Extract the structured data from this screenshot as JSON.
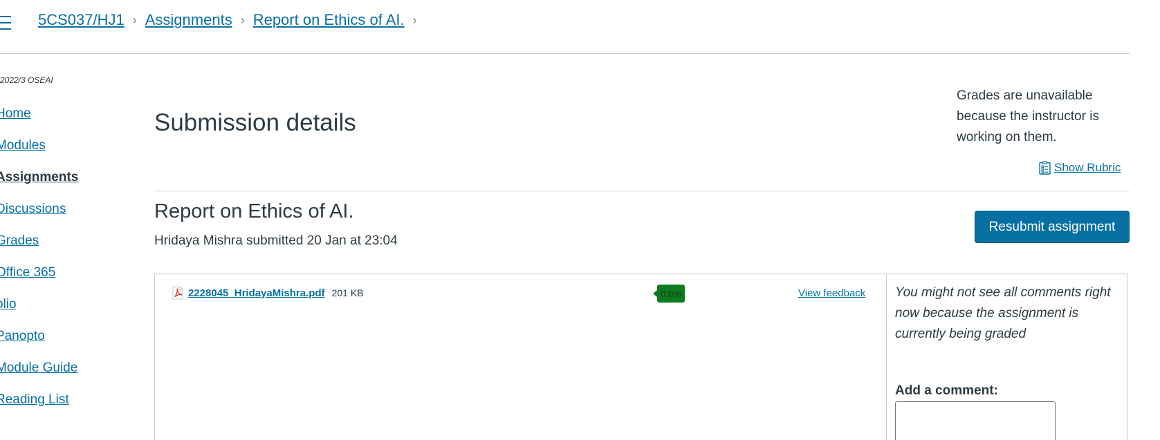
{
  "breadcrumb": {
    "course": "5CS037/HJ1",
    "assignments": "Assignments",
    "current": "Report on Ethics of AI."
  },
  "sidebar": {
    "term": "2022/3 OSEAI",
    "items": [
      {
        "label": "Home"
      },
      {
        "label": "Modules"
      },
      {
        "label": "Assignments"
      },
      {
        "label": "Discussions"
      },
      {
        "label": "Grades"
      },
      {
        "label": "Office 365"
      },
      {
        "label": "olio"
      },
      {
        "label": "Panopto"
      },
      {
        "label": "Module Guide"
      },
      {
        "label": "Reading List"
      }
    ]
  },
  "main": {
    "title": "Submission details",
    "grades_note": "Grades are unavailable because the instructor is working on them.",
    "show_rubric": "Show Rubric",
    "assignment_title": "Report on Ethics of AI.",
    "submitted_line": "Hridaya Mishra submitted 20 Jan at 23:04",
    "resubmit_label": "Resubmit assignment"
  },
  "submission": {
    "file_name": "2228045_HridayaMishra.pdf",
    "file_size": "201 KB",
    "score": "0.0%",
    "view_feedback": "View feedback",
    "comments_note": "You might not see all comments right now because the assignment is currently being graded",
    "add_comment_label": "Add a comment:"
  },
  "colors": {
    "link": "#0770a3",
    "button": "#0770a3",
    "score_badge": "#0a7d1e"
  }
}
